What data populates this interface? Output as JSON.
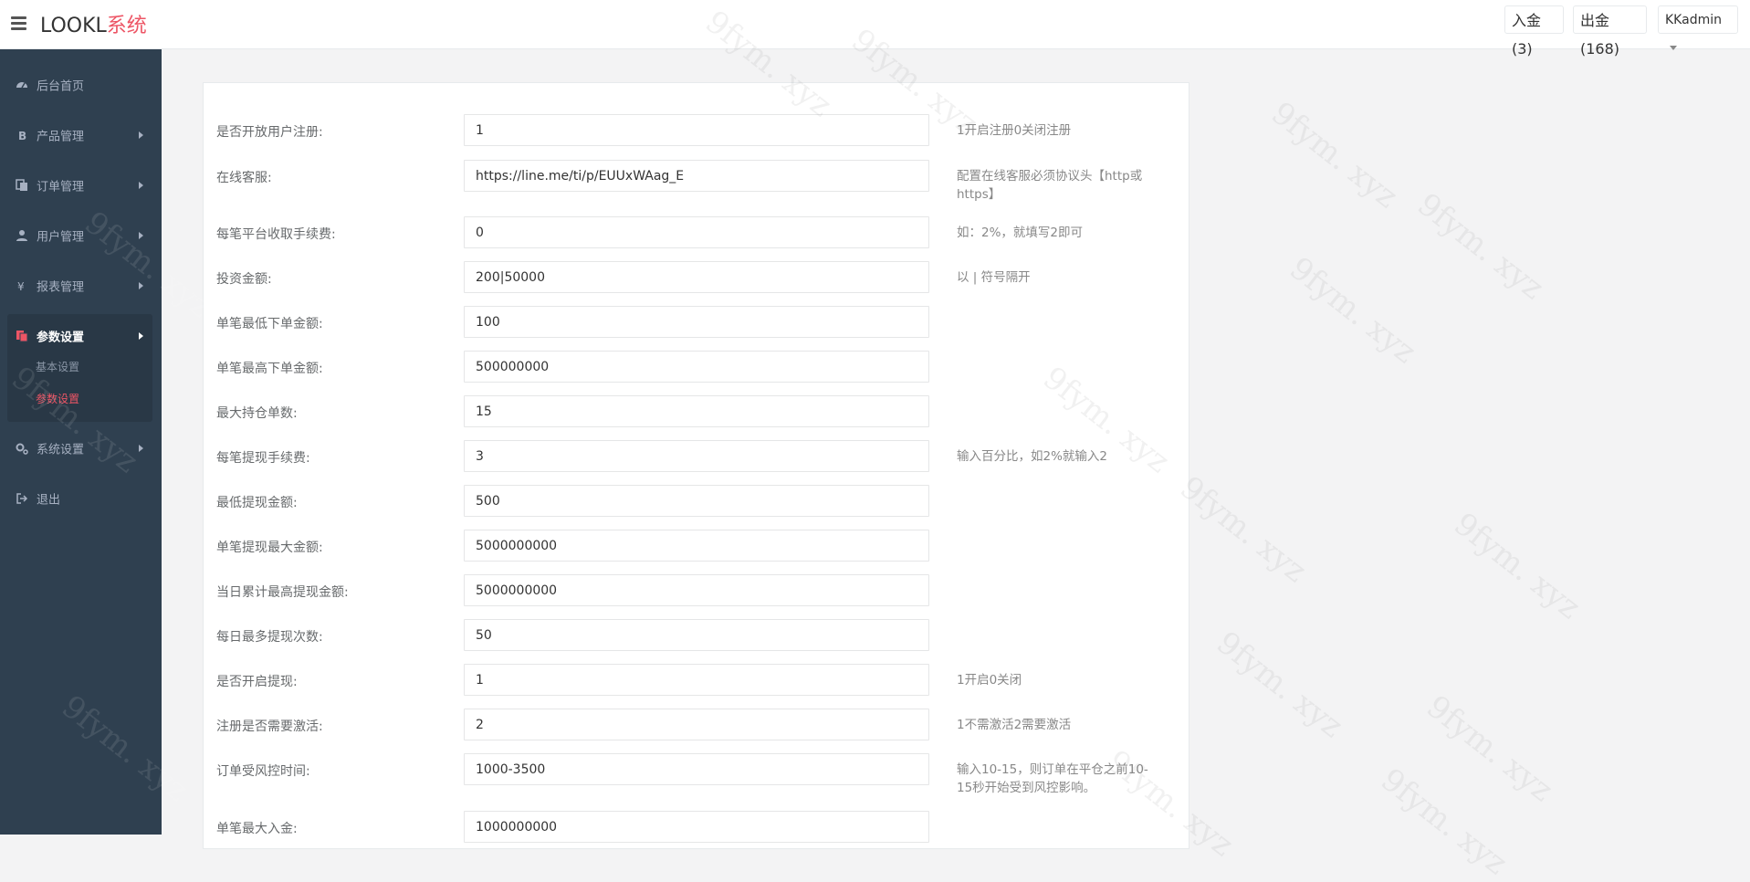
{
  "header": {
    "brand_main": "LOOKL",
    "brand_accent": "系统",
    "deposit_label": "入金(3)",
    "withdraw_label": "出金(168)",
    "user_label": "KKadmin"
  },
  "sidebar": {
    "items": [
      {
        "label": "后台首页",
        "icon": "dashboard-icon",
        "has_arrow": false
      },
      {
        "label": "产品管理",
        "icon": "bitcoin-icon",
        "has_arrow": true
      },
      {
        "label": "订单管理",
        "icon": "copy-icon",
        "has_arrow": true
      },
      {
        "label": "用户管理",
        "icon": "user-icon",
        "has_arrow": true
      },
      {
        "label": "报表管理",
        "icon": "yen-icon",
        "has_arrow": true
      },
      {
        "label": "参数设置",
        "icon": "files-icon",
        "has_arrow": true
      },
      {
        "label": "系统设置",
        "icon": "gears-icon",
        "has_arrow": true
      },
      {
        "label": "退出",
        "icon": "sign-out-icon",
        "has_arrow": false
      }
    ],
    "subitems": [
      {
        "label": "基本设置"
      },
      {
        "label": "参数设置"
      }
    ]
  },
  "form": {
    "rows": [
      {
        "label": "是否开放用户注册:",
        "value": "1",
        "hint": "1开启注册0关闭注册"
      },
      {
        "label": "在线客服:",
        "value": "https://line.me/ti/p/EUUxWAag_E",
        "hint": "配置在线客服必须协议头【http或https】"
      },
      {
        "label": "每笔平台收取手续费:",
        "value": "0",
        "hint": "如：2%，就填写2即可"
      },
      {
        "label": "投资金额:",
        "value": "200|50000",
        "hint": "以 | 符号隔开"
      },
      {
        "label": "单笔最低下单金额:",
        "value": "100",
        "hint": ""
      },
      {
        "label": "单笔最高下单金额:",
        "value": "500000000",
        "hint": ""
      },
      {
        "label": "最大持仓单数:",
        "value": "15",
        "hint": ""
      },
      {
        "label": "每笔提现手续费:",
        "value": "3",
        "hint": "输入百分比，如2%就输入2"
      },
      {
        "label": "最低提现金额:",
        "value": "500",
        "hint": ""
      },
      {
        "label": "单笔提现最大金额:",
        "value": "5000000000",
        "hint": ""
      },
      {
        "label": "当日累计最高提现金额:",
        "value": "5000000000",
        "hint": ""
      },
      {
        "label": "每日最多提现次数:",
        "value": "50",
        "hint": ""
      },
      {
        "label": "是否开启提现:",
        "value": "1",
        "hint": "1开启0关闭"
      },
      {
        "label": "注册是否需要激活:",
        "value": "2",
        "hint": "1不需激活2需要激活"
      },
      {
        "label": "订单受风控时间:",
        "value": "1000-3500",
        "hint": "输入10-15，则订单在平仓之前10-15秒开始受到风控影响。"
      },
      {
        "label": "单笔最大入金:",
        "value": "1000000000",
        "hint": ""
      }
    ]
  },
  "watermark_text": "9fym. xyz",
  "colors": {
    "sidebar_bg": "#2f4050",
    "accent": "#ed5565"
  }
}
